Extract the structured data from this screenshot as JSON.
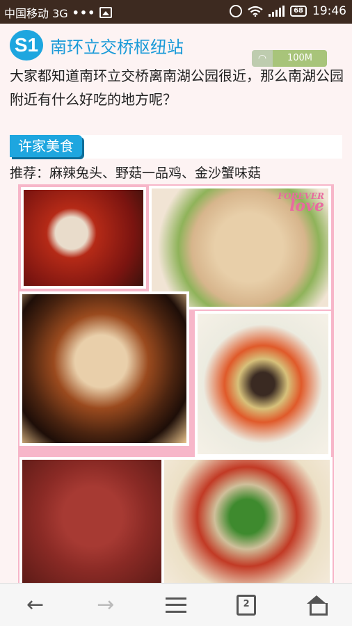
{
  "status_bar": {
    "carrier": "中国移动 3G",
    "dots": "•••",
    "battery": "68",
    "time": "19:46"
  },
  "header": {
    "badge": "S1",
    "title": "南环立交桥枢纽站"
  },
  "overlay": {
    "data_usage": "100M"
  },
  "intro_text": "大家都知道南环立交桥离南湖公园很近，那么南湖公园附近有什么好吃的地方呢？",
  "restaurant": {
    "name": "许家美食",
    "recommend": "推荐：麻辣兔头、野菇一品鸡、金沙蟹味菇"
  },
  "collage": {
    "watermark_top": "FOREVER",
    "watermark_bottom": "love"
  },
  "nav": {
    "back_icon": "arrow-left-icon",
    "forward_icon": "arrow-right-icon",
    "menu_icon": "menu-icon",
    "tabs_count": "2",
    "home_icon": "home-icon"
  }
}
